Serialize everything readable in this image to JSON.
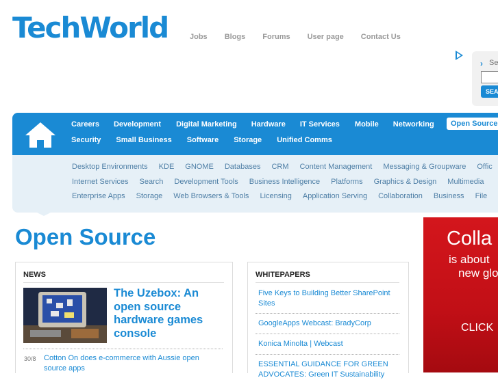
{
  "brand": {
    "logo": "TechWorld",
    "accent": "#1a8ad4"
  },
  "toplinks": [
    "Jobs",
    "Blogs",
    "Forums",
    "User page",
    "Contact Us"
  ],
  "search": {
    "label": "Se",
    "button": "SEA"
  },
  "nav": {
    "row1": [
      "Careers",
      "Development",
      "Digital Marketing",
      "Hardware",
      "IT Services",
      "Mobile",
      "Networking",
      "Open Source"
    ],
    "row2": [
      "Security",
      "Small Business",
      "Software",
      "Storage",
      "Unified Comms"
    ],
    "active": "Open Source"
  },
  "subnav": {
    "row1": [
      "Desktop Environments",
      "KDE",
      "GNOME",
      "Databases",
      "CRM",
      "Content Management",
      "Messaging & Groupware",
      "Offic"
    ],
    "row2": [
      "Internet Services",
      "Search",
      "Development Tools",
      "Business Intelligence",
      "Platforms",
      "Graphics & Design",
      "Multimedia"
    ],
    "row3": [
      "Enterprise Apps",
      "Storage",
      "Web Browsers & Tools",
      "Licensing",
      "Application Serving",
      "Collaboration",
      "Business",
      "File"
    ]
  },
  "page": {
    "title": "Open Source"
  },
  "news": {
    "heading": "NEWS",
    "featured": {
      "title": "The Uzebox: An open source hardware games console"
    },
    "items": [
      {
        "date": "30/8",
        "title": "Cotton On does e-commerce with Aussie open source apps"
      }
    ]
  },
  "whitepapers": {
    "heading": "WHITEPAPERS",
    "items": [
      "Five Keys to Building Better SharePoint Sites",
      "GoogleApps Webcast: BradyCorp",
      "Konica Minolta | Webcast",
      "ESSENTIAL GUIDANCE FOR GREEN ADVOCATES: Green IT Sustainability"
    ]
  },
  "advert": {
    "line1": "Colla",
    "line2": "is about",
    "line3": "new glo",
    "cta": "CLICK"
  }
}
